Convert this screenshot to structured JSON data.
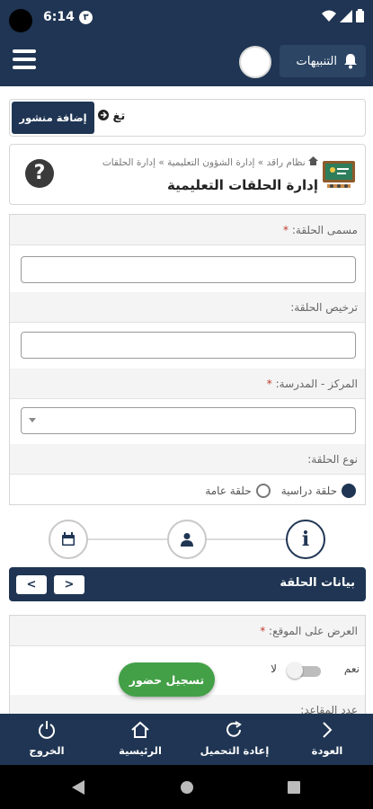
{
  "status_bar": {
    "time": "6:14",
    "notification_badge": "٣"
  },
  "app_bar": {
    "notifications_label": "التنبيهات"
  },
  "post_bar": {
    "add_post_label": "إضافة منشور",
    "ticker_text": "تغ"
  },
  "page_header": {
    "breadcrumb": [
      "نظام راقد",
      "إدارة الشؤون التعليمية",
      "إدارة الحلقات"
    ],
    "breadcrumb_sep": "»",
    "title": "إدارة الحلقات التعليمية",
    "help_symbol": "?"
  },
  "form": {
    "circle_name_label": "مسمى الحلقة:",
    "circle_license_label": "ترخيص الحلقة:",
    "center_school_label": "المركز - المدرسة:",
    "circle_type_label": "نوع الحلقة:",
    "required_mark": "*",
    "circle_type_options": [
      {
        "label": "حلقة دراسية",
        "selected": true
      },
      {
        "label": "حلقة عامة",
        "selected": false
      }
    ]
  },
  "steps": {
    "icons": [
      "info-icon",
      "person-icon",
      "calendar-icon"
    ],
    "info_symbol": "i"
  },
  "section": {
    "title": "بيانات الحلقة",
    "prev_arrow": "<",
    "next_arrow": ">"
  },
  "form2": {
    "display_on_site_label": "العرض على الموقع:",
    "yes_label": "نعم",
    "no_label": "لا",
    "seats_label": "عدد المقاعد:"
  },
  "attend_button": "تسجيل حضور",
  "bottom_nav": {
    "back": "العودة",
    "reload": "إعادة التحميل",
    "home": "الرئيسية",
    "logout": "الخروج"
  },
  "colors": {
    "primary": "#1f3553",
    "accent_green": "#43a047",
    "required": "#c0392b"
  }
}
